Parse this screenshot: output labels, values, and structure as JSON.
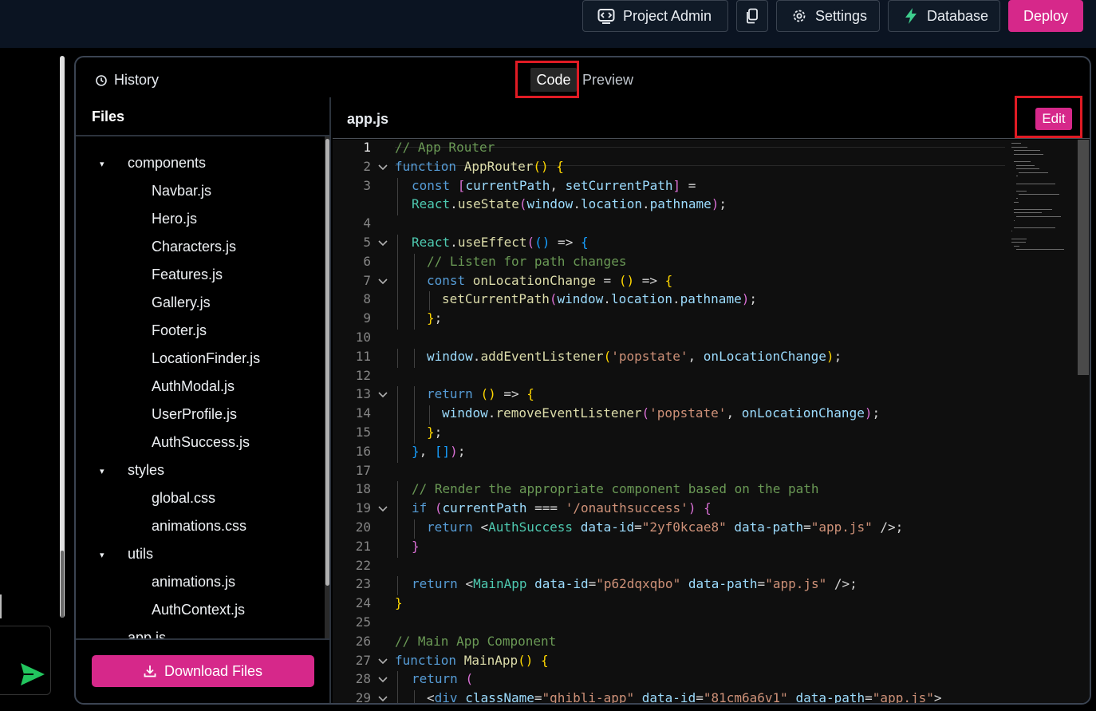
{
  "topbar": {
    "project_admin": "Project Admin",
    "settings": "Settings",
    "database": "Database",
    "deploy": "Deploy"
  },
  "panel": {
    "history": "History",
    "tab_code": "Code",
    "tab_preview": "Preview"
  },
  "files": {
    "title": "Files",
    "download": "Download Files",
    "tree": [
      {
        "label": "components",
        "folder": true,
        "depth": 0
      },
      {
        "label": "Navbar.js",
        "folder": false,
        "depth": 1
      },
      {
        "label": "Hero.js",
        "folder": false,
        "depth": 1
      },
      {
        "label": "Characters.js",
        "folder": false,
        "depth": 1
      },
      {
        "label": "Features.js",
        "folder": false,
        "depth": 1
      },
      {
        "label": "Gallery.js",
        "folder": false,
        "depth": 1
      },
      {
        "label": "Footer.js",
        "folder": false,
        "depth": 1
      },
      {
        "label": "LocationFinder.js",
        "folder": false,
        "depth": 1
      },
      {
        "label": "AuthModal.js",
        "folder": false,
        "depth": 1
      },
      {
        "label": "UserProfile.js",
        "folder": false,
        "depth": 1
      },
      {
        "label": "AuthSuccess.js",
        "folder": false,
        "depth": 1
      },
      {
        "label": "styles",
        "folder": true,
        "depth": 0
      },
      {
        "label": "global.css",
        "folder": false,
        "depth": 1
      },
      {
        "label": "animations.css",
        "folder": false,
        "depth": 1
      },
      {
        "label": "utils",
        "folder": true,
        "depth": 0
      },
      {
        "label": "animations.js",
        "folder": false,
        "depth": 1
      },
      {
        "label": "AuthContext.js",
        "folder": false,
        "depth": 1
      },
      {
        "label": "app.js",
        "folder": false,
        "depth": 0
      }
    ]
  },
  "editor": {
    "filename": "app.js",
    "edit": "Edit",
    "lines": [
      {
        "n": "1",
        "fold": false,
        "indent": 0,
        "tokens": [
          [
            "c",
            "// App Router"
          ]
        ]
      },
      {
        "n": "2",
        "fold": true,
        "indent": 0,
        "tokens": [
          [
            "k",
            "function "
          ],
          [
            "f",
            "AppRouter"
          ],
          [
            "y",
            "() {"
          ]
        ]
      },
      {
        "n": "3",
        "fold": false,
        "indent": 1,
        "tokens": [
          [
            "k",
            "const "
          ],
          [
            "m",
            "["
          ],
          [
            "p",
            "currentPath"
          ],
          [
            "w",
            ", "
          ],
          [
            "p",
            "setCurrentPath"
          ],
          [
            "m",
            "]"
          ],
          [
            "w",
            " ="
          ]
        ]
      },
      {
        "n": "",
        "fold": false,
        "indent": 1,
        "tokens": [
          [
            "t",
            "React"
          ],
          [
            "w",
            "."
          ],
          [
            "f",
            "useState"
          ],
          [
            "m",
            "("
          ],
          [
            "p",
            "window"
          ],
          [
            "w",
            "."
          ],
          [
            "p",
            "location"
          ],
          [
            "w",
            "."
          ],
          [
            "p",
            "pathname"
          ],
          [
            "m",
            ")"
          ],
          [
            "w",
            ";"
          ]
        ]
      },
      {
        "n": "4",
        "fold": false,
        "indent": 0,
        "tokens": []
      },
      {
        "n": "5",
        "fold": true,
        "indent": 1,
        "tokens": [
          [
            "t",
            "React"
          ],
          [
            "w",
            "."
          ],
          [
            "f",
            "useEffect"
          ],
          [
            "m",
            "("
          ],
          [
            "b",
            "()"
          ],
          [
            "w",
            " => "
          ],
          [
            "b",
            "{"
          ]
        ]
      },
      {
        "n": "6",
        "fold": false,
        "indent": 2,
        "tokens": [
          [
            "c",
            "// Listen for path changes"
          ]
        ]
      },
      {
        "n": "7",
        "fold": true,
        "indent": 2,
        "tokens": [
          [
            "k",
            "const "
          ],
          [
            "f",
            "onLocationChange"
          ],
          [
            "w",
            " = "
          ],
          [
            "y",
            "()"
          ],
          [
            "w",
            " => "
          ],
          [
            "y",
            "{"
          ]
        ]
      },
      {
        "n": "8",
        "fold": false,
        "indent": 3,
        "tokens": [
          [
            "f",
            "setCurrentPath"
          ],
          [
            "m",
            "("
          ],
          [
            "p",
            "window"
          ],
          [
            "w",
            "."
          ],
          [
            "p",
            "location"
          ],
          [
            "w",
            "."
          ],
          [
            "p",
            "pathname"
          ],
          [
            "m",
            ")"
          ],
          [
            "w",
            ";"
          ]
        ]
      },
      {
        "n": "9",
        "fold": false,
        "indent": 2,
        "tokens": [
          [
            "y",
            "}"
          ],
          [
            "w",
            ";"
          ]
        ]
      },
      {
        "n": "10",
        "fold": false,
        "indent": 0,
        "tokens": []
      },
      {
        "n": "11",
        "fold": false,
        "indent": 2,
        "tokens": [
          [
            "p",
            "window"
          ],
          [
            "w",
            "."
          ],
          [
            "f",
            "addEventListener"
          ],
          [
            "y",
            "("
          ],
          [
            "s",
            "'popstate'"
          ],
          [
            "w",
            ", "
          ],
          [
            "p",
            "onLocationChange"
          ],
          [
            "y",
            ")"
          ],
          [
            "w",
            ";"
          ]
        ]
      },
      {
        "n": "12",
        "fold": false,
        "indent": 0,
        "tokens": []
      },
      {
        "n": "13",
        "fold": true,
        "indent": 2,
        "tokens": [
          [
            "k",
            "return "
          ],
          [
            "y",
            "()"
          ],
          [
            "w",
            " => "
          ],
          [
            "y",
            "{"
          ]
        ]
      },
      {
        "n": "14",
        "fold": false,
        "indent": 3,
        "tokens": [
          [
            "p",
            "window"
          ],
          [
            "w",
            "."
          ],
          [
            "f",
            "removeEventListener"
          ],
          [
            "m",
            "("
          ],
          [
            "s",
            "'popstate'"
          ],
          [
            "w",
            ", "
          ],
          [
            "p",
            "onLocationChange"
          ],
          [
            "m",
            ")"
          ],
          [
            "w",
            ";"
          ]
        ]
      },
      {
        "n": "15",
        "fold": false,
        "indent": 2,
        "tokens": [
          [
            "y",
            "}"
          ],
          [
            "w",
            ";"
          ]
        ]
      },
      {
        "n": "16",
        "fold": false,
        "indent": 1,
        "tokens": [
          [
            "b",
            "}"
          ],
          [
            "w",
            ", "
          ],
          [
            "b",
            "[]"
          ],
          [
            "m",
            ")"
          ],
          [
            "w",
            ";"
          ]
        ]
      },
      {
        "n": "17",
        "fold": false,
        "indent": 0,
        "tokens": []
      },
      {
        "n": "18",
        "fold": false,
        "indent": 1,
        "tokens": [
          [
            "c",
            "// Render the appropriate component based on the path"
          ]
        ]
      },
      {
        "n": "19",
        "fold": true,
        "indent": 1,
        "tokens": [
          [
            "k",
            "if "
          ],
          [
            "m",
            "("
          ],
          [
            "p",
            "currentPath"
          ],
          [
            "w",
            " === "
          ],
          [
            "s",
            "'/onauthsuccess'"
          ],
          [
            "m",
            ")"
          ],
          [
            "w",
            " "
          ],
          [
            "m",
            "{"
          ]
        ]
      },
      {
        "n": "20",
        "fold": false,
        "indent": 2,
        "tokens": [
          [
            "k",
            "return "
          ],
          [
            "w",
            "<"
          ],
          [
            "t",
            "AuthSuccess"
          ],
          [
            "w",
            " "
          ],
          [
            "p",
            "data-id"
          ],
          [
            "w",
            "="
          ],
          [
            "s",
            "\"2yf0kcae8\""
          ],
          [
            "w",
            " "
          ],
          [
            "p",
            "data-path"
          ],
          [
            "w",
            "="
          ],
          [
            "s",
            "\"app.js\""
          ],
          [
            "w",
            " />;"
          ]
        ]
      },
      {
        "n": "21",
        "fold": false,
        "indent": 1,
        "tokens": [
          [
            "m",
            "}"
          ]
        ]
      },
      {
        "n": "22",
        "fold": false,
        "indent": 0,
        "tokens": []
      },
      {
        "n": "23",
        "fold": false,
        "indent": 1,
        "tokens": [
          [
            "k",
            "return "
          ],
          [
            "w",
            "<"
          ],
          [
            "t",
            "MainApp"
          ],
          [
            "w",
            " "
          ],
          [
            "p",
            "data-id"
          ],
          [
            "w",
            "="
          ],
          [
            "s",
            "\"p62dqxqbo\""
          ],
          [
            "w",
            " "
          ],
          [
            "p",
            "data-path"
          ],
          [
            "w",
            "="
          ],
          [
            "s",
            "\"app.js\""
          ],
          [
            "w",
            " />;"
          ]
        ]
      },
      {
        "n": "24",
        "fold": false,
        "indent": 0,
        "tokens": [
          [
            "y",
            "}"
          ]
        ]
      },
      {
        "n": "25",
        "fold": false,
        "indent": 0,
        "tokens": []
      },
      {
        "n": "26",
        "fold": false,
        "indent": 0,
        "tokens": [
          [
            "c",
            "// Main App Component"
          ]
        ]
      },
      {
        "n": "27",
        "fold": true,
        "indent": 0,
        "tokens": [
          [
            "k",
            "function "
          ],
          [
            "f",
            "MainApp"
          ],
          [
            "y",
            "() {"
          ]
        ]
      },
      {
        "n": "28",
        "fold": true,
        "indent": 1,
        "tokens": [
          [
            "k",
            "return "
          ],
          [
            "m",
            "("
          ]
        ]
      },
      {
        "n": "29",
        "fold": true,
        "indent": 2,
        "tokens": [
          [
            "w",
            "<"
          ],
          [
            "k",
            "div"
          ],
          [
            "w",
            " "
          ],
          [
            "p",
            "className"
          ],
          [
            "w",
            "="
          ],
          [
            "s",
            "\"ghibli-app\""
          ],
          [
            "w",
            " "
          ],
          [
            "p",
            "data-id"
          ],
          [
            "w",
            "="
          ],
          [
            "s",
            "\"81cm6a6v1\""
          ],
          [
            "w",
            " "
          ],
          [
            "p",
            "data-path"
          ],
          [
            "w",
            "="
          ],
          [
            "s",
            "\"app.js\""
          ],
          [
            "w",
            ">"
          ]
        ]
      }
    ]
  }
}
